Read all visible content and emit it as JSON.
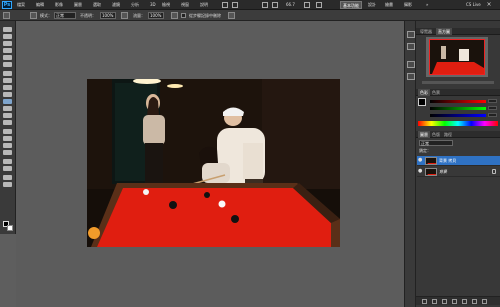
{
  "colors": {
    "accent": "#2f72c4",
    "felt": "#e01e10",
    "chrome_dark": "#2a2a2a",
    "canvas_gray": "#5c5c5c"
  },
  "app": {
    "logo": "Ps",
    "menus": [
      "檔案",
      "編輯",
      "影像",
      "圖層",
      "選取",
      "濾鏡",
      "分析",
      "3D",
      "檢視",
      "視窗",
      "說明"
    ],
    "zoom": "66.7",
    "workspaces": [
      "基本功能",
      "設計",
      "繪畫",
      "攝影"
    ],
    "cs_live": "CS Live"
  },
  "options_bar": {
    "mode_label": "模式：",
    "mode_value": "正常",
    "opacity_label": "不透明：",
    "opacity_value": "100%",
    "flow_label": "流量：",
    "flow_value": "100%",
    "checkbox_label": "從步驟記錄中刪除"
  },
  "panels": {
    "navigator_tabs": [
      "導覽器",
      "直方圖"
    ],
    "color_tabs": [
      "色彩",
      "色票"
    ],
    "layers_tabs": [
      "圖層",
      "色版",
      "路徑"
    ],
    "blend_mode": "正常",
    "lock_label": "鎖定：",
    "layers": [
      {
        "name": "背景 拷貝",
        "selected": true
      },
      {
        "name": "背景",
        "selected": false
      }
    ]
  }
}
